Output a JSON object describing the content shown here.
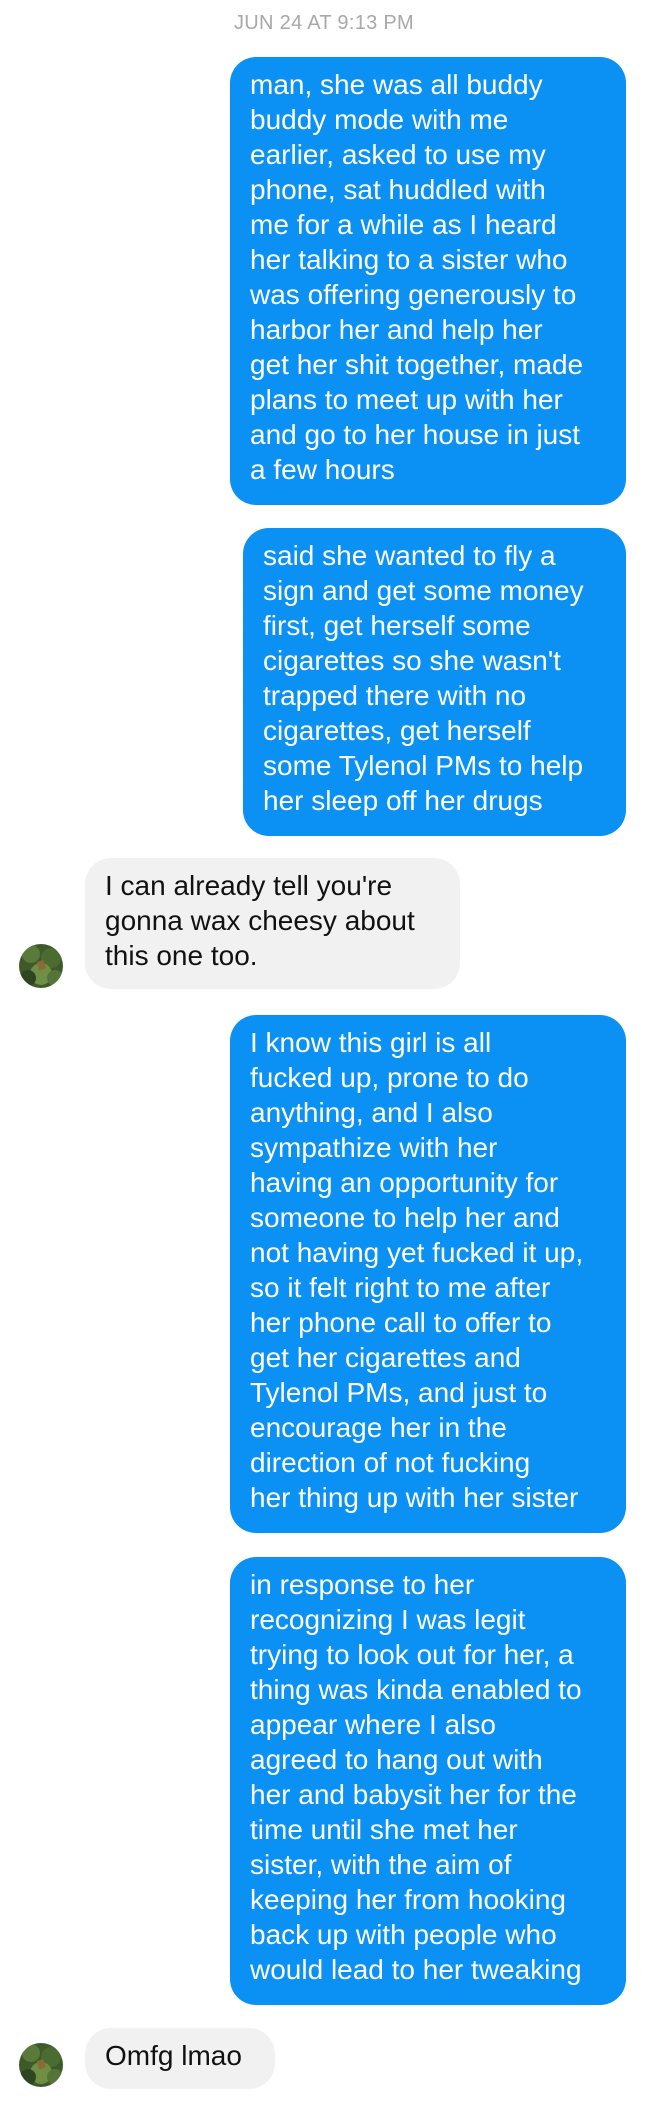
{
  "conversation": {
    "timestamp": "JUN 24 AT 9:13 PM",
    "messages": [
      {
        "sender": "me",
        "text": "man, she was all buddy\nbuddy mode with me\nearlier, asked to use my\nphone, sat huddled with\nme for a while as I heard\nher talking to a sister who\nwas offering generously to\nharbor her and help her\nget her shit together, made\nplans to meet up with her\nand go to her house in just\na few hours"
      },
      {
        "sender": "me",
        "text": "said she wanted to fly a\nsign and get some money\nfirst, get herself some\ncigarettes so she wasn't\ntrapped there with no\ncigarettes, get herself\nsome Tylenol PMs to help\nher sleep off her drugs"
      },
      {
        "sender": "friend",
        "text": "I can already tell you're\ngonna wax cheesy about\nthis one too."
      },
      {
        "sender": "me",
        "text": "I know this girl is all\nfucked up, prone to do\nanything, and I also\nsympathize with her\nhaving an opportunity for\nsomeone to help her and\nnot having yet fucked it up,\nso it felt right to me after\nher phone call to offer to\nget her cigarettes and\nTylenol PMs, and just to\nencourage her in the\ndirection of not fucking\nher thing up with her sister"
      },
      {
        "sender": "me",
        "text": "in response to her\nrecognizing I was legit\ntrying to look out for her, a\nthing was kinda enabled to\nappear where I also\nagreed to hang out with\nher and babysit her for the\ntime until she met her\nsister, with the aim of\nkeeping her from hooking\nback up with people who\nwould lead to her tweaking"
      },
      {
        "sender": "friend",
        "text": "Omfg lmao"
      }
    ]
  },
  "colors": {
    "outgoing_bubble": "#0a91f3",
    "incoming_bubble": "#f1f1f1",
    "timestamp_text": "#a8a8a8"
  },
  "icons": {
    "avatar": "contact-avatar-photo"
  }
}
